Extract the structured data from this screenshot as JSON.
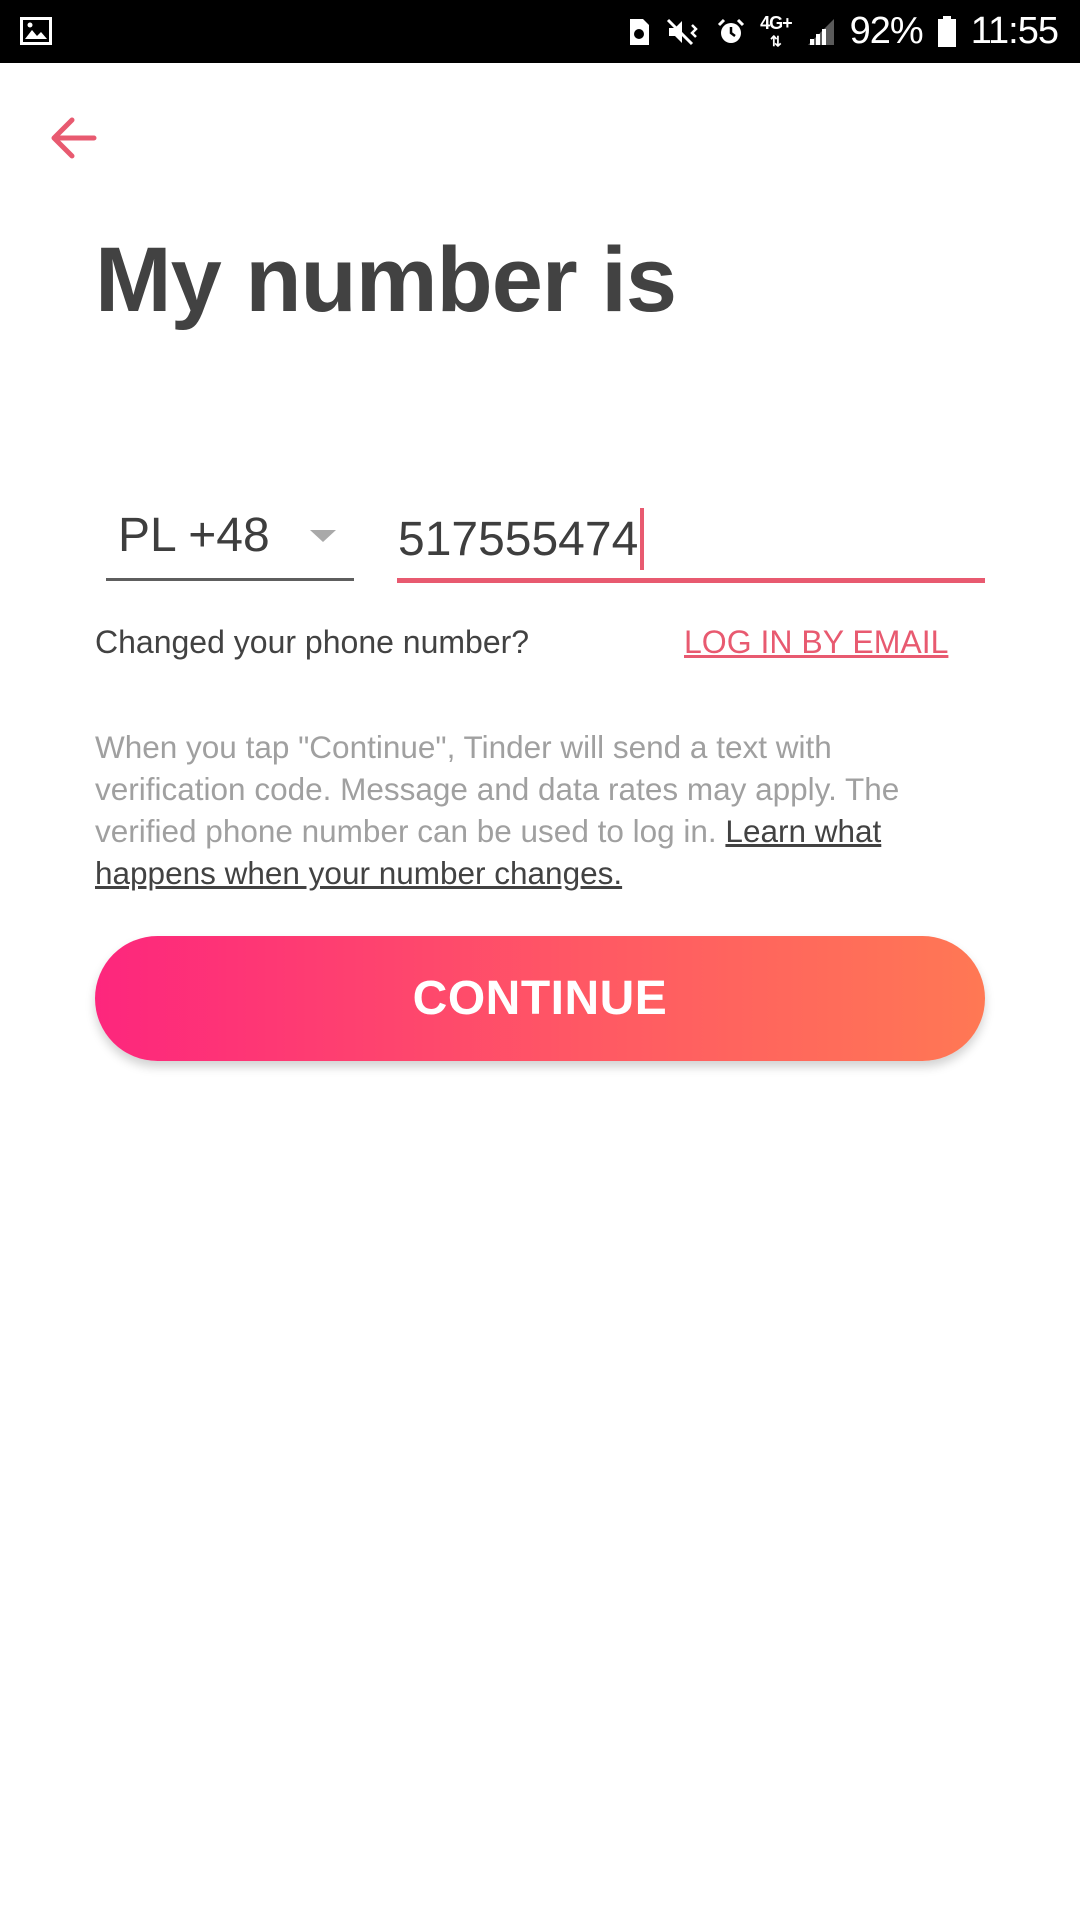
{
  "status_bar": {
    "battery_percent": "92%",
    "time": "11:55",
    "network_type": "4G+",
    "icons": [
      "gallery-icon",
      "sim-icon",
      "mute-vibrate-icon",
      "alarm-icon",
      "network-4g-icon",
      "signal-icon",
      "battery-icon"
    ]
  },
  "header": {
    "back_icon": "arrow-left-icon",
    "title": "My number is"
  },
  "form": {
    "country_code": "PL +48",
    "phone_number": "517555474",
    "changed_prompt": "Changed your phone number?",
    "email_login_link": "LOG IN BY EMAIL"
  },
  "disclaimer": {
    "text": "When you tap \"Continue\", Tinder will send a text with verification code. Message and data rates may apply. The verified phone number can be used to log in. ",
    "link": "Learn what happens when your number changes."
  },
  "continue_button": {
    "label": "CONTINUE"
  },
  "colors": {
    "accent": "#e85a70",
    "gradient_start": "#fd267d",
    "gradient_end": "#ff7854",
    "title": "#424242",
    "muted_text": "#a0a0a0"
  }
}
